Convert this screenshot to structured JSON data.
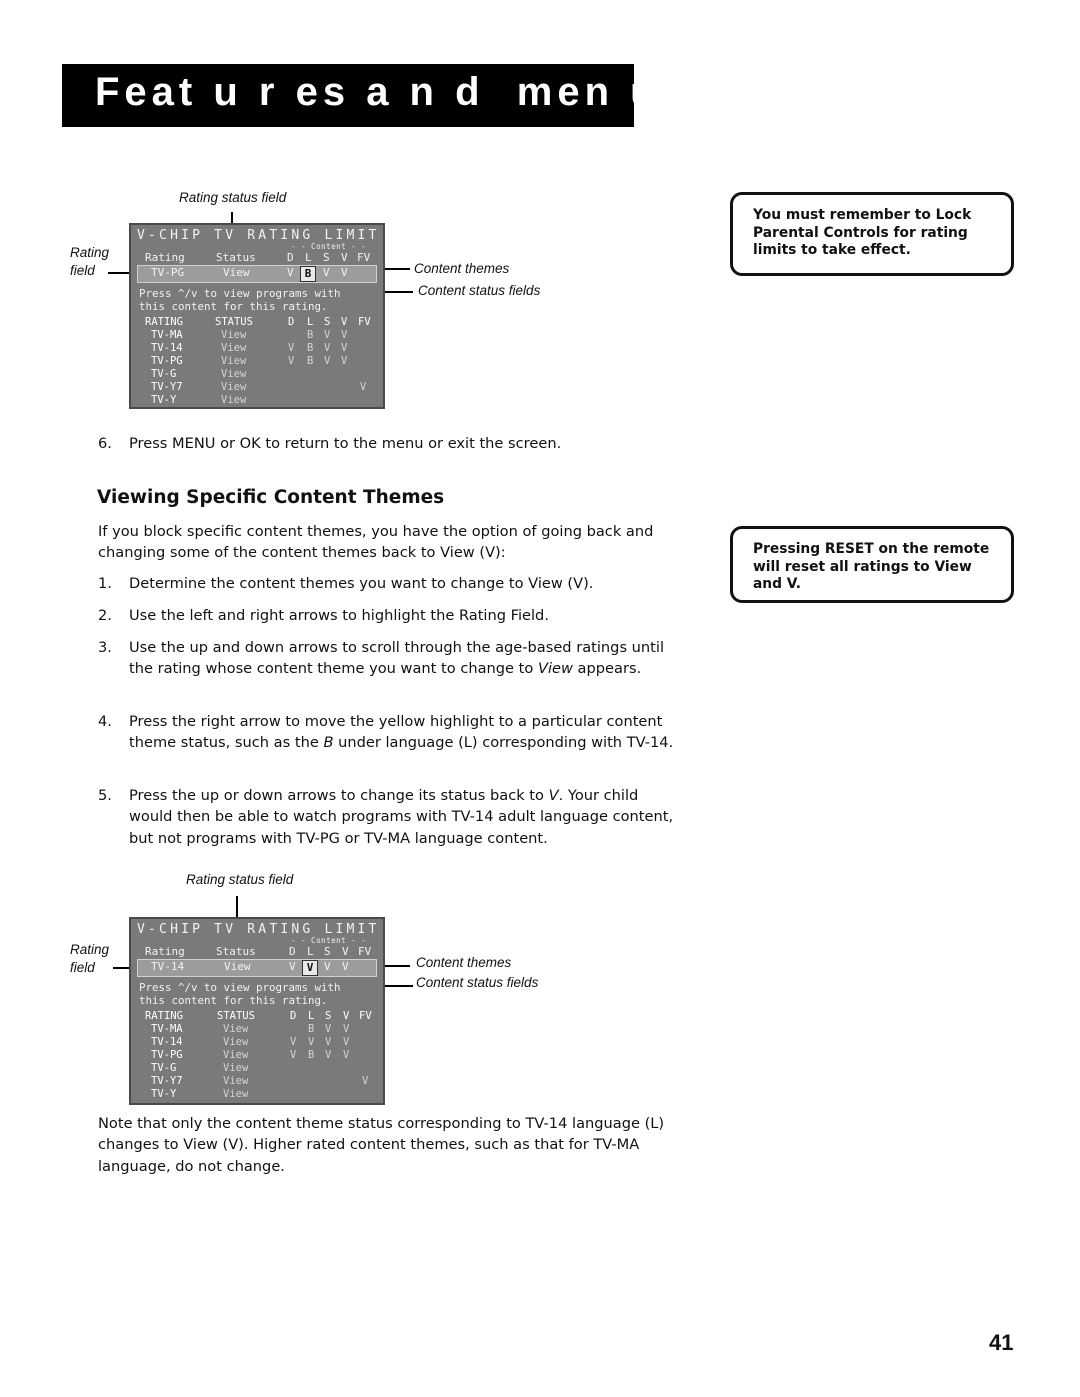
{
  "header": {
    "title": "Feat u r es a n d  men u s"
  },
  "figures": [
    {
      "callouts": {
        "rating_status_field": "Rating status field",
        "rating_field_line1": "Rating",
        "rating_field_line2": "field",
        "content_themes": "Content themes",
        "content_status_fields": "Content status fields"
      },
      "screen": {
        "title": "V-CHIP TV RATING LIMIT",
        "content_label": "- - Content - -",
        "header": {
          "rating": "Rating",
          "status": "Status",
          "cols": [
            "D",
            "L",
            "S",
            "V",
            "FV"
          ]
        },
        "current": {
          "rating": "TV-PG",
          "status": "View",
          "values": [
            "V",
            "B",
            "V",
            "V",
            ""
          ],
          "selected_index": 1
        },
        "message": "Press ^/v to view programs with\nthis content for this rating.",
        "table_header": {
          "rating": "RATING",
          "status": "STATUS",
          "cols": [
            "D",
            "L",
            "S",
            "V",
            "FV"
          ]
        },
        "rows": [
          {
            "rating": "TV-MA",
            "status": "View",
            "values": [
              "",
              "B",
              "V",
              "V",
              ""
            ]
          },
          {
            "rating": "TV-14",
            "status": "View",
            "values": [
              "V",
              "B",
              "V",
              "V",
              ""
            ]
          },
          {
            "rating": "TV-PG",
            "status": "View",
            "values": [
              "V",
              "B",
              "V",
              "V",
              ""
            ]
          },
          {
            "rating": "TV-G",
            "status": "View",
            "values": [
              "",
              "",
              "",
              "",
              ""
            ]
          },
          {
            "rating": "TV-Y7",
            "status": "View",
            "values": [
              "",
              "",
              "",
              "",
              "V"
            ]
          },
          {
            "rating": "TV-Y",
            "status": "View",
            "values": [
              "",
              "",
              "",
              "",
              ""
            ]
          }
        ]
      }
    },
    {
      "callouts": {
        "rating_status_field": "Rating status field",
        "rating_field_line1": "Rating",
        "rating_field_line2": "field",
        "content_themes": "Content themes",
        "content_status_fields": "Content status fields"
      },
      "screen": {
        "title": "V-CHIP TV RATING LIMIT",
        "content_label": "- - Content - -",
        "header": {
          "rating": "Rating",
          "status": "Status",
          "cols": [
            "D",
            "L",
            "S",
            "V",
            "FV"
          ]
        },
        "current": {
          "rating": "TV-14",
          "status": "View",
          "values": [
            "V",
            "V",
            "V",
            "V",
            ""
          ],
          "selected_index": 1
        },
        "message": "Press ^/v to view programs with\nthis content for this rating.",
        "table_header": {
          "rating": "RATING",
          "status": "STATUS",
          "cols": [
            "D",
            "L",
            "S",
            "V",
            "FV"
          ]
        },
        "rows": [
          {
            "rating": "TV-MA",
            "status": "View",
            "values": [
              "",
              "B",
              "V",
              "V",
              ""
            ]
          },
          {
            "rating": "TV-14",
            "status": "View",
            "values": [
              "V",
              "V",
              "V",
              "V",
              ""
            ]
          },
          {
            "rating": "TV-PG",
            "status": "View",
            "values": [
              "V",
              "B",
              "V",
              "V",
              ""
            ]
          },
          {
            "rating": "TV-G",
            "status": "View",
            "values": [
              "",
              "",
              "",
              "",
              ""
            ]
          },
          {
            "rating": "TV-Y7",
            "status": "View",
            "values": [
              "",
              "",
              "",
              "",
              "V"
            ]
          },
          {
            "rating": "TV-Y",
            "status": "View",
            "values": [
              "",
              "",
              "",
              "",
              ""
            ]
          }
        ]
      }
    }
  ],
  "body": {
    "step6": {
      "num": "6.",
      "text": "Press MENU or OK to return to the menu or exit the screen."
    },
    "heading": "Viewing Specific Content Themes",
    "intro": "If you block specific content themes, you have the option of going back and changing some of the content themes back to View (V):",
    "steps": [
      {
        "num": "1.",
        "text": "Determine the content themes you want to change to View (V)."
      },
      {
        "num": "2.",
        "text": "Use the left and right arrows to highlight the Rating Field."
      },
      {
        "num": "3.",
        "text_a": "Use the up and down arrows to scroll through the age-based ratings until the rating whose content theme you want to change to ",
        "text_em": "View",
        "text_b": " appears."
      },
      {
        "num": "4.",
        "text_a": "Press the right arrow to move the yellow highlight to a particular content theme status, such as the ",
        "text_em": "B",
        "text_b": " under language (L) corresponding with TV-14."
      },
      {
        "num": "5.",
        "text_a": "Press the up or down arrows to change its status back to ",
        "text_em": "V",
        "text_b": ".  Your child would then be able to watch programs with TV-14 adult language content, but not programs with  TV-PG or TV-MA language content."
      }
    ],
    "note": "Note that only the content theme status corresponding to TV-14 language (L) changes to View (V). Higher rated content themes, such as that for TV-MA language, do not change."
  },
  "sidebar_notes": [
    "You must remember to Lock Parental Controls for rating limits to take effect.",
    "Pressing RESET on the remote will reset all ratings to View and V."
  ],
  "page_number": "41"
}
